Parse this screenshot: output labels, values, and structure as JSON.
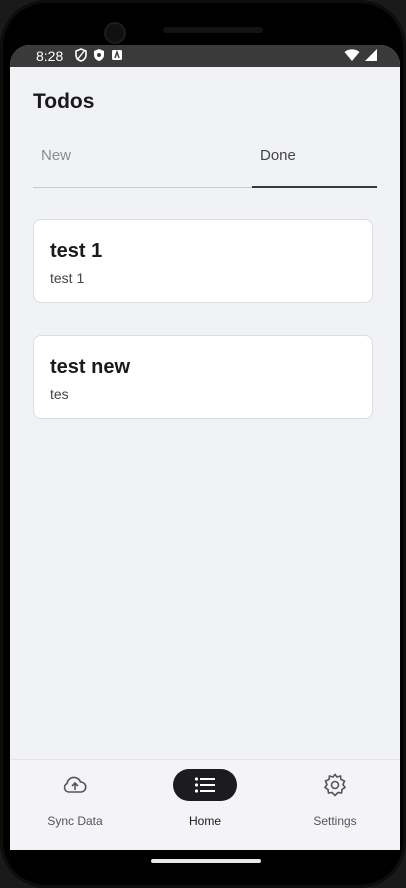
{
  "status_bar": {
    "time": "8:28",
    "left_icons": [
      "shield-icon",
      "privacy-icon",
      "android-icon"
    ],
    "right_icons": [
      "wifi-icon",
      "signal-icon"
    ]
  },
  "app": {
    "title": "Todos"
  },
  "tabs": [
    {
      "label": "New",
      "selected": false
    },
    {
      "label": "Done",
      "selected": true
    }
  ],
  "todos": [
    {
      "title": "test 1",
      "description": "test 1"
    },
    {
      "title": "test new",
      "description": "tes"
    }
  ],
  "bottom_nav": [
    {
      "label": "Sync Data",
      "icon": "cloud-upload-icon",
      "selected": false
    },
    {
      "label": "Home",
      "icon": "list-icon",
      "selected": true
    },
    {
      "label": "Settings",
      "icon": "gear-icon",
      "selected": false
    }
  ],
  "colors": {
    "background": "#f1f2f6",
    "selected_pill": "#1c1c1e",
    "card": "#ffffff"
  }
}
